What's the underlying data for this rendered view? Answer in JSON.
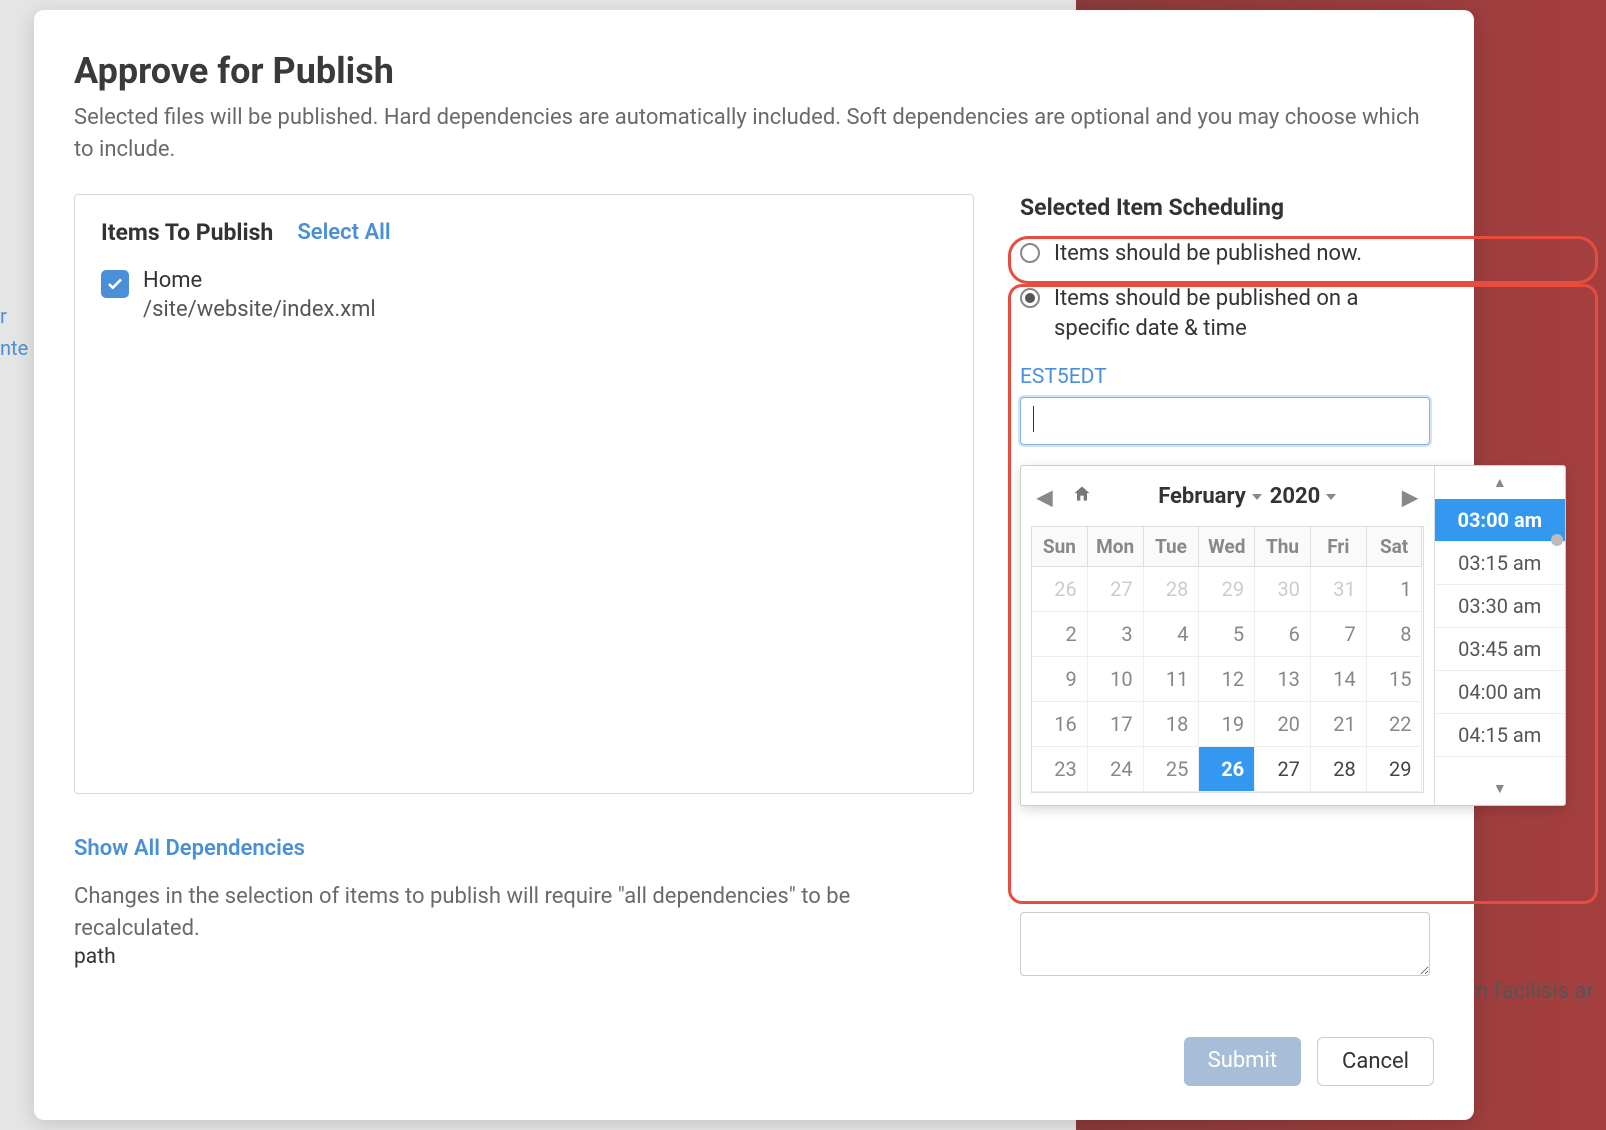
{
  "backdrop": {
    "right_text": "m facilisis ar",
    "left_text_1": "r",
    "left_text_2": "nte"
  },
  "modal": {
    "title": "Approve for Publish",
    "description": "Selected files will be published. Hard dependencies are automatically included. Soft dependencies are optional and you may choose which to include."
  },
  "items_panel": {
    "title": "Items To Publish",
    "select_all": "Select All",
    "items": [
      {
        "name": "Home",
        "path": "/site/website/index.xml",
        "checked": true
      }
    ]
  },
  "deps": {
    "show_link": "Show All Dependencies",
    "note": "Changes in the selection of items to publish will require \"all dependencies\" to be recalculated."
  },
  "scheduling": {
    "title": "Selected Item Scheduling",
    "option_now": "Items should be published now.",
    "option_date": "Items should be published on a specific date & time",
    "selected": "date",
    "timezone": "EST5EDT",
    "input_value": ""
  },
  "calendar": {
    "month": "February",
    "year": "2020",
    "dow": [
      "Sun",
      "Mon",
      "Tue",
      "Wed",
      "Thu",
      "Fri",
      "Sat"
    ],
    "rows": [
      [
        {
          "d": "26",
          "t": "faded"
        },
        {
          "d": "27",
          "t": "faded"
        },
        {
          "d": "28",
          "t": "faded"
        },
        {
          "d": "29",
          "t": "faded"
        },
        {
          "d": "30",
          "t": "faded"
        },
        {
          "d": "31",
          "t": "faded"
        },
        {
          "d": "1",
          "t": "in"
        }
      ],
      [
        {
          "d": "2",
          "t": "in"
        },
        {
          "d": "3",
          "t": "in"
        },
        {
          "d": "4",
          "t": "in"
        },
        {
          "d": "5",
          "t": "in"
        },
        {
          "d": "6",
          "t": "in"
        },
        {
          "d": "7",
          "t": "in"
        },
        {
          "d": "8",
          "t": "in"
        }
      ],
      [
        {
          "d": "9",
          "t": "in"
        },
        {
          "d": "10",
          "t": "in"
        },
        {
          "d": "11",
          "t": "in"
        },
        {
          "d": "12",
          "t": "in"
        },
        {
          "d": "13",
          "t": "in"
        },
        {
          "d": "14",
          "t": "in"
        },
        {
          "d": "15",
          "t": "in"
        }
      ],
      [
        {
          "d": "16",
          "t": "in"
        },
        {
          "d": "17",
          "t": "in"
        },
        {
          "d": "18",
          "t": "in"
        },
        {
          "d": "19",
          "t": "in"
        },
        {
          "d": "20",
          "t": "in"
        },
        {
          "d": "21",
          "t": "in"
        },
        {
          "d": "22",
          "t": "in"
        }
      ],
      [
        {
          "d": "23",
          "t": "in"
        },
        {
          "d": "24",
          "t": "in"
        },
        {
          "d": "25",
          "t": "in"
        },
        {
          "d": "26",
          "t": "sel"
        },
        {
          "d": "27",
          "t": "curr"
        },
        {
          "d": "28",
          "t": "curr"
        },
        {
          "d": "29",
          "t": "curr"
        }
      ]
    ],
    "times": [
      "03:00 am",
      "03:15 am",
      "03:30 am",
      "03:45 am",
      "04:00 am",
      "04:15 am"
    ],
    "time_selected": "03:00 am"
  },
  "buttons": {
    "submit": "Submit",
    "cancel": "Cancel"
  }
}
